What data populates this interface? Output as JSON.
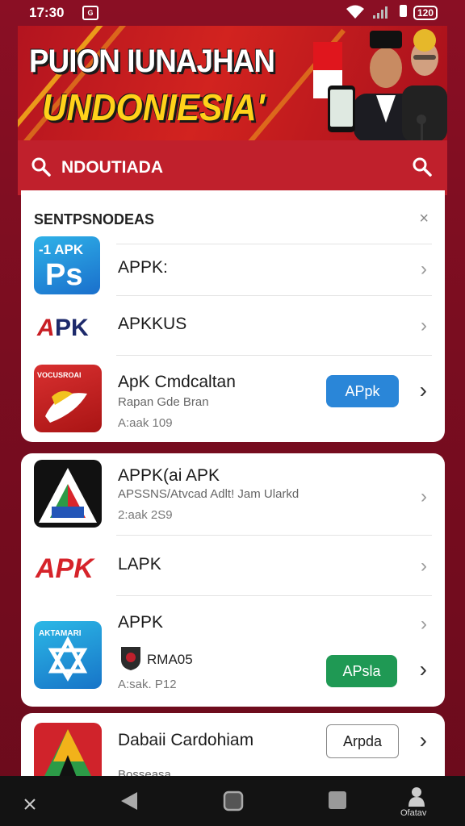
{
  "status_bar": {
    "time": "17:30",
    "battery": "120"
  },
  "banner": {
    "line1": "PUION IUNAJHAN",
    "line2": "UNDONIESIA'"
  },
  "search": {
    "text": "NDOUTIADA"
  },
  "section": {
    "title": "SENTPSNODEAS",
    "close": "×"
  },
  "apps": [
    {
      "title": "APPK:"
    },
    {
      "title": "APKKUS"
    },
    {
      "title": "ApK Cmdcaltan",
      "subtitle": "Rapan Gde Bran",
      "meta": "A:aak 109",
      "button": "APpk",
      "icon_label": "VOCUSROAI"
    },
    {
      "title": "APPK(ai APK",
      "subtitle": "APSSNS/Atvcad Adlt! Jam Ularkd",
      "meta": "2:aak 2S9"
    },
    {
      "title": "LAPK"
    },
    {
      "title": "APPK",
      "subtitle": "RMA05",
      "meta": "A:sak. P12",
      "button": "APsla",
      "icon_label": "AKTAMARI"
    },
    {
      "title": "Dabaii Cardohiam",
      "subtitle": "Bosseasa",
      "button": "Arpda"
    }
  ],
  "nav": {
    "profile_label": "Ofatav"
  }
}
